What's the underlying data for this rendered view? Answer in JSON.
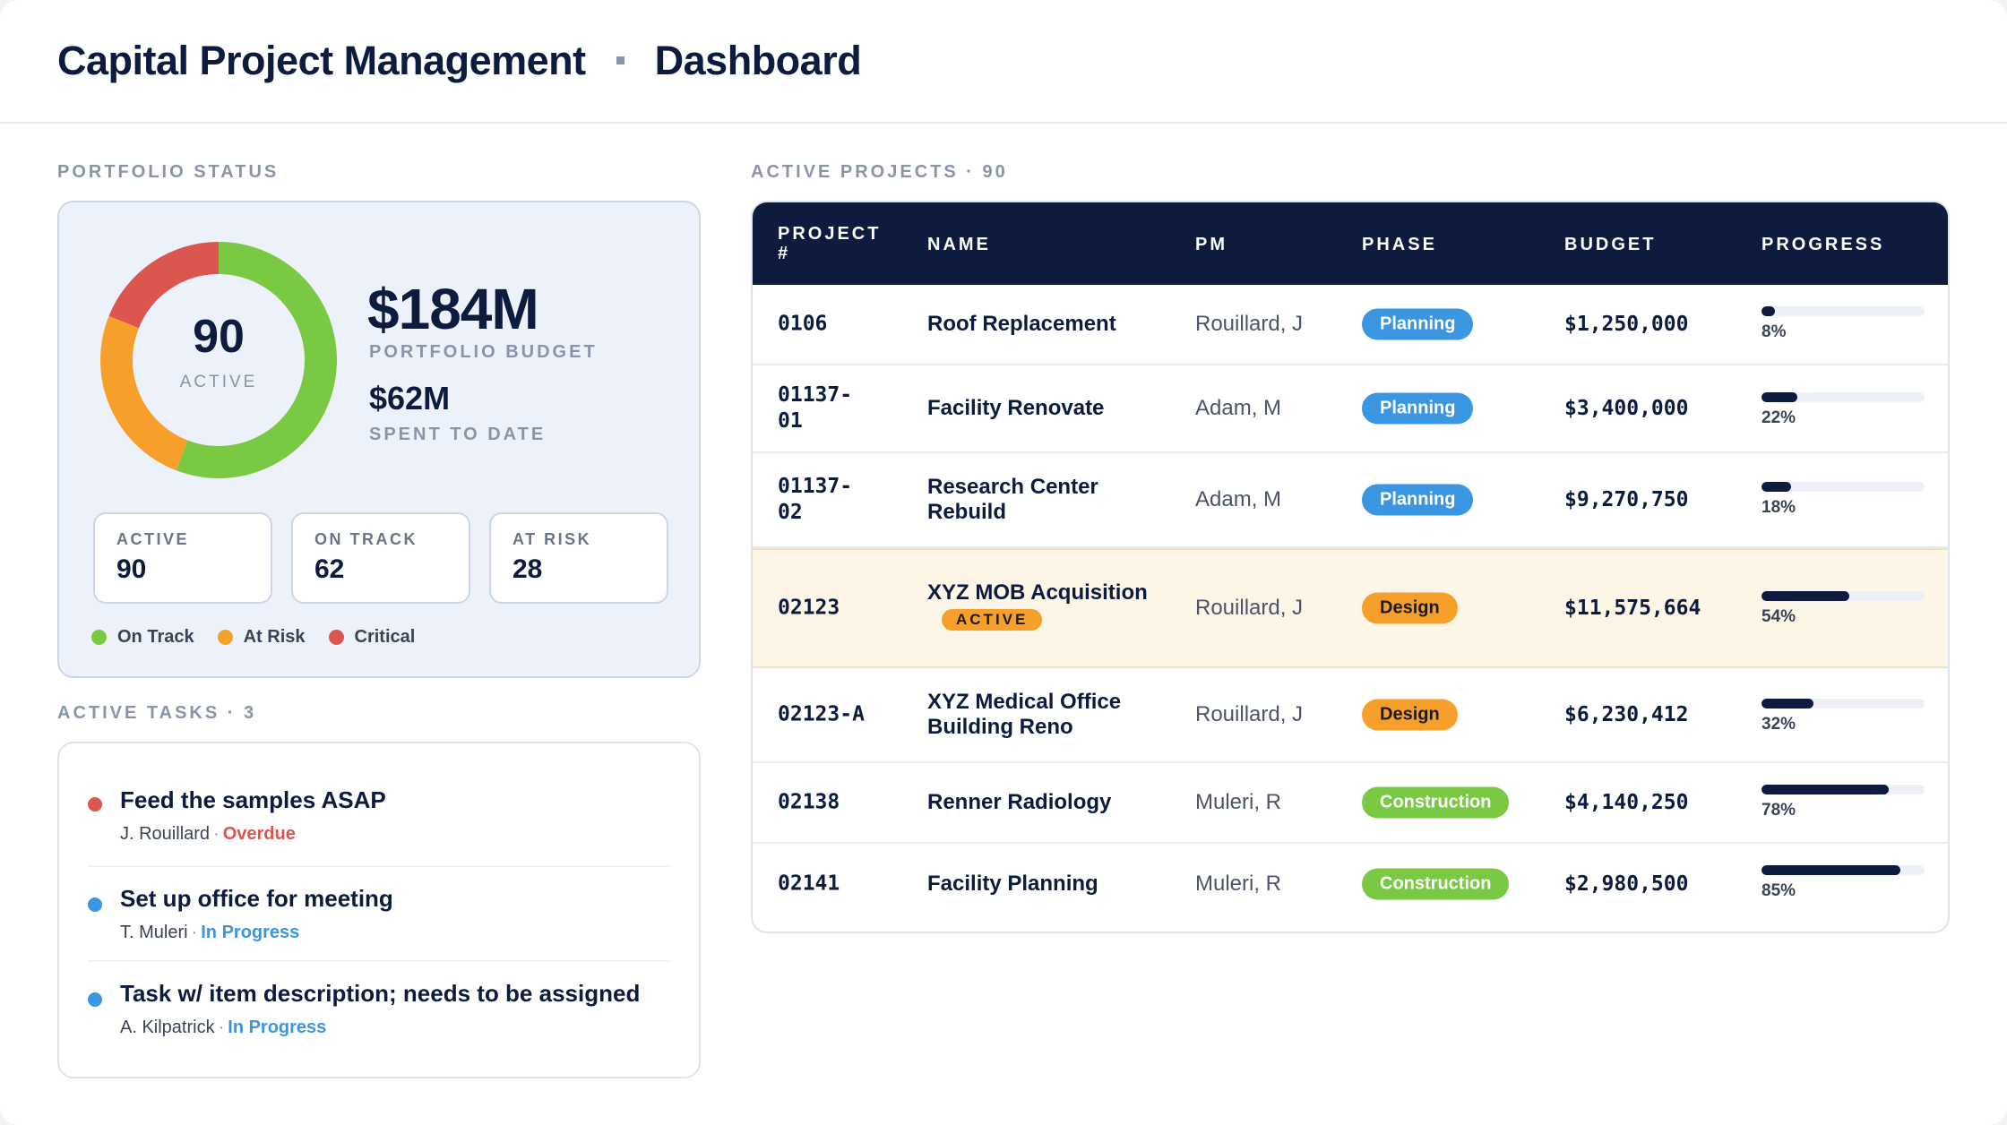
{
  "header": {
    "title": "Capital Project Management",
    "subtitle": "Dashboard"
  },
  "portfolio": {
    "section_label": "PORTFOLIO STATUS",
    "donut": {
      "center_value": "90",
      "center_label": "ACTIVE",
      "segments": [
        {
          "name": "On Track",
          "value": 62,
          "color": "#7ac943"
        },
        {
          "name": "At Risk",
          "value": 28,
          "color": "#f6a02b"
        },
        {
          "name": "Critical",
          "value": 21,
          "color": "#dc5650"
        }
      ]
    },
    "budget_value": "$184M",
    "budget_label": "PORTFOLIO BUDGET",
    "spent_value": "$62M",
    "spent_label": "SPENT TO DATE",
    "stats": [
      {
        "label": "ACTIVE",
        "value": "90"
      },
      {
        "label": "ON TRACK",
        "value": "62"
      },
      {
        "label": "AT RISK",
        "value": "28"
      }
    ],
    "legend": [
      {
        "label": "On Track",
        "color": "#7ac943"
      },
      {
        "label": "At Risk",
        "color": "#f6a02b"
      },
      {
        "label": "Critical",
        "color": "#dc5650"
      }
    ]
  },
  "tasks": {
    "section_label": "ACTIVE TASKS · 3",
    "items": [
      {
        "title": "Feed the samples ASAP",
        "assignee": "J. Rouillard",
        "status": "Overdue",
        "dot_color": "#dc5650",
        "status_color": "#dc5650"
      },
      {
        "title": "Set up office for meeting",
        "assignee": "T. Muleri",
        "status": "In Progress",
        "dot_color": "#3b96e1",
        "status_color": "#3b96e1"
      },
      {
        "title": "Task w/ item description; needs to be assigned",
        "assignee": "A. Kilpatrick",
        "status": "In Progress",
        "dot_color": "#3b96e1",
        "status_color": "#3b96e1"
      }
    ]
  },
  "projects": {
    "section_label": "ACTIVE PROJECTS · 90",
    "columns": {
      "number": "PROJECT #",
      "name": "NAME",
      "pm": "PM",
      "phase": "PHASE",
      "budget": "BUDGET",
      "progress": "PROGRESS"
    },
    "rows": [
      {
        "number": "0106",
        "name": "Roof Replacement",
        "pm": "Rouillard, J",
        "phase": "Planning",
        "phase_class": "planning",
        "budget": "$1,250,000",
        "progress": 8,
        "progress_label": "8%"
      },
      {
        "number": "01137-01",
        "name": "Facility Renovate",
        "pm": "Adam, M",
        "phase": "Planning",
        "phase_class": "planning",
        "budget": "$3,400,000",
        "progress": 22,
        "progress_label": "22%"
      },
      {
        "number": "01137-02",
        "name": "Research Center Rebuild",
        "pm": "Adam, M",
        "phase": "Planning",
        "phase_class": "planning",
        "budget": "$9,270,750",
        "progress": 18,
        "progress_label": "18%"
      },
      {
        "number": "02123",
        "name": "XYZ MOB Acquisition",
        "badge": "ACTIVE",
        "pm": "Rouillard, J",
        "phase": "Design",
        "phase_class": "design",
        "budget": "$11,575,664",
        "progress": 54,
        "progress_label": "54%",
        "highlight": true
      },
      {
        "number": "02123-A",
        "name": "XYZ Medical Office Building Reno",
        "pm": "Rouillard, J",
        "phase": "Design",
        "phase_class": "design",
        "budget": "$6,230,412",
        "progress": 32,
        "progress_label": "32%"
      },
      {
        "number": "02138",
        "name": "Renner Radiology",
        "pm": "Muleri, R",
        "phase": "Construction",
        "phase_class": "construction",
        "budget": "$4,140,250",
        "progress": 78,
        "progress_label": "78%"
      },
      {
        "number": "02141",
        "name": "Facility Planning",
        "pm": "Muleri, R",
        "phase": "Construction",
        "phase_class": "construction",
        "budget": "$2,980,500",
        "progress": 85,
        "progress_label": "85%"
      }
    ]
  }
}
